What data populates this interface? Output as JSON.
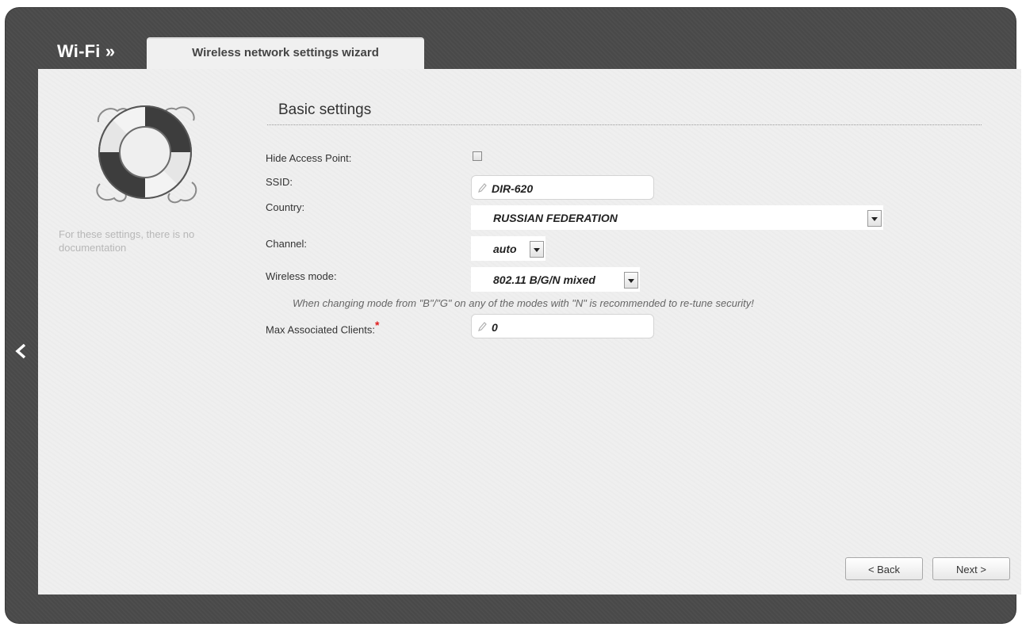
{
  "header": {
    "brand": "Wi-Fi »",
    "tab_label": "Wireless network settings wizard"
  },
  "sidebar": {
    "note": "For these settings, there is no documentation"
  },
  "section": {
    "title": "Basic settings"
  },
  "fields": {
    "hide_ap": {
      "label": "Hide Access Point:",
      "checked": false
    },
    "ssid": {
      "label": "SSID:",
      "value": "DIR-620"
    },
    "country": {
      "label": "Country:",
      "value": "RUSSIAN FEDERATION"
    },
    "channel": {
      "label": "Channel:",
      "value": "auto"
    },
    "wireless_mode": {
      "label": "Wireless mode:",
      "value": "802.11 B/G/N mixed"
    },
    "mode_hint": "When changing mode from \"B\"/\"G\" on any of the modes with \"N\" is recommended to re-tune security!",
    "max_clients": {
      "label": "Max Associated Clients:",
      "required_mark": "*",
      "value": "0"
    }
  },
  "buttons": {
    "back": "< Back",
    "next": "Next >"
  },
  "icons": {
    "nav_back": "‹",
    "pencil": "pencil-icon",
    "lifebuoy": "lifebuoy-icon",
    "dropdown": "chevron-down-icon"
  }
}
